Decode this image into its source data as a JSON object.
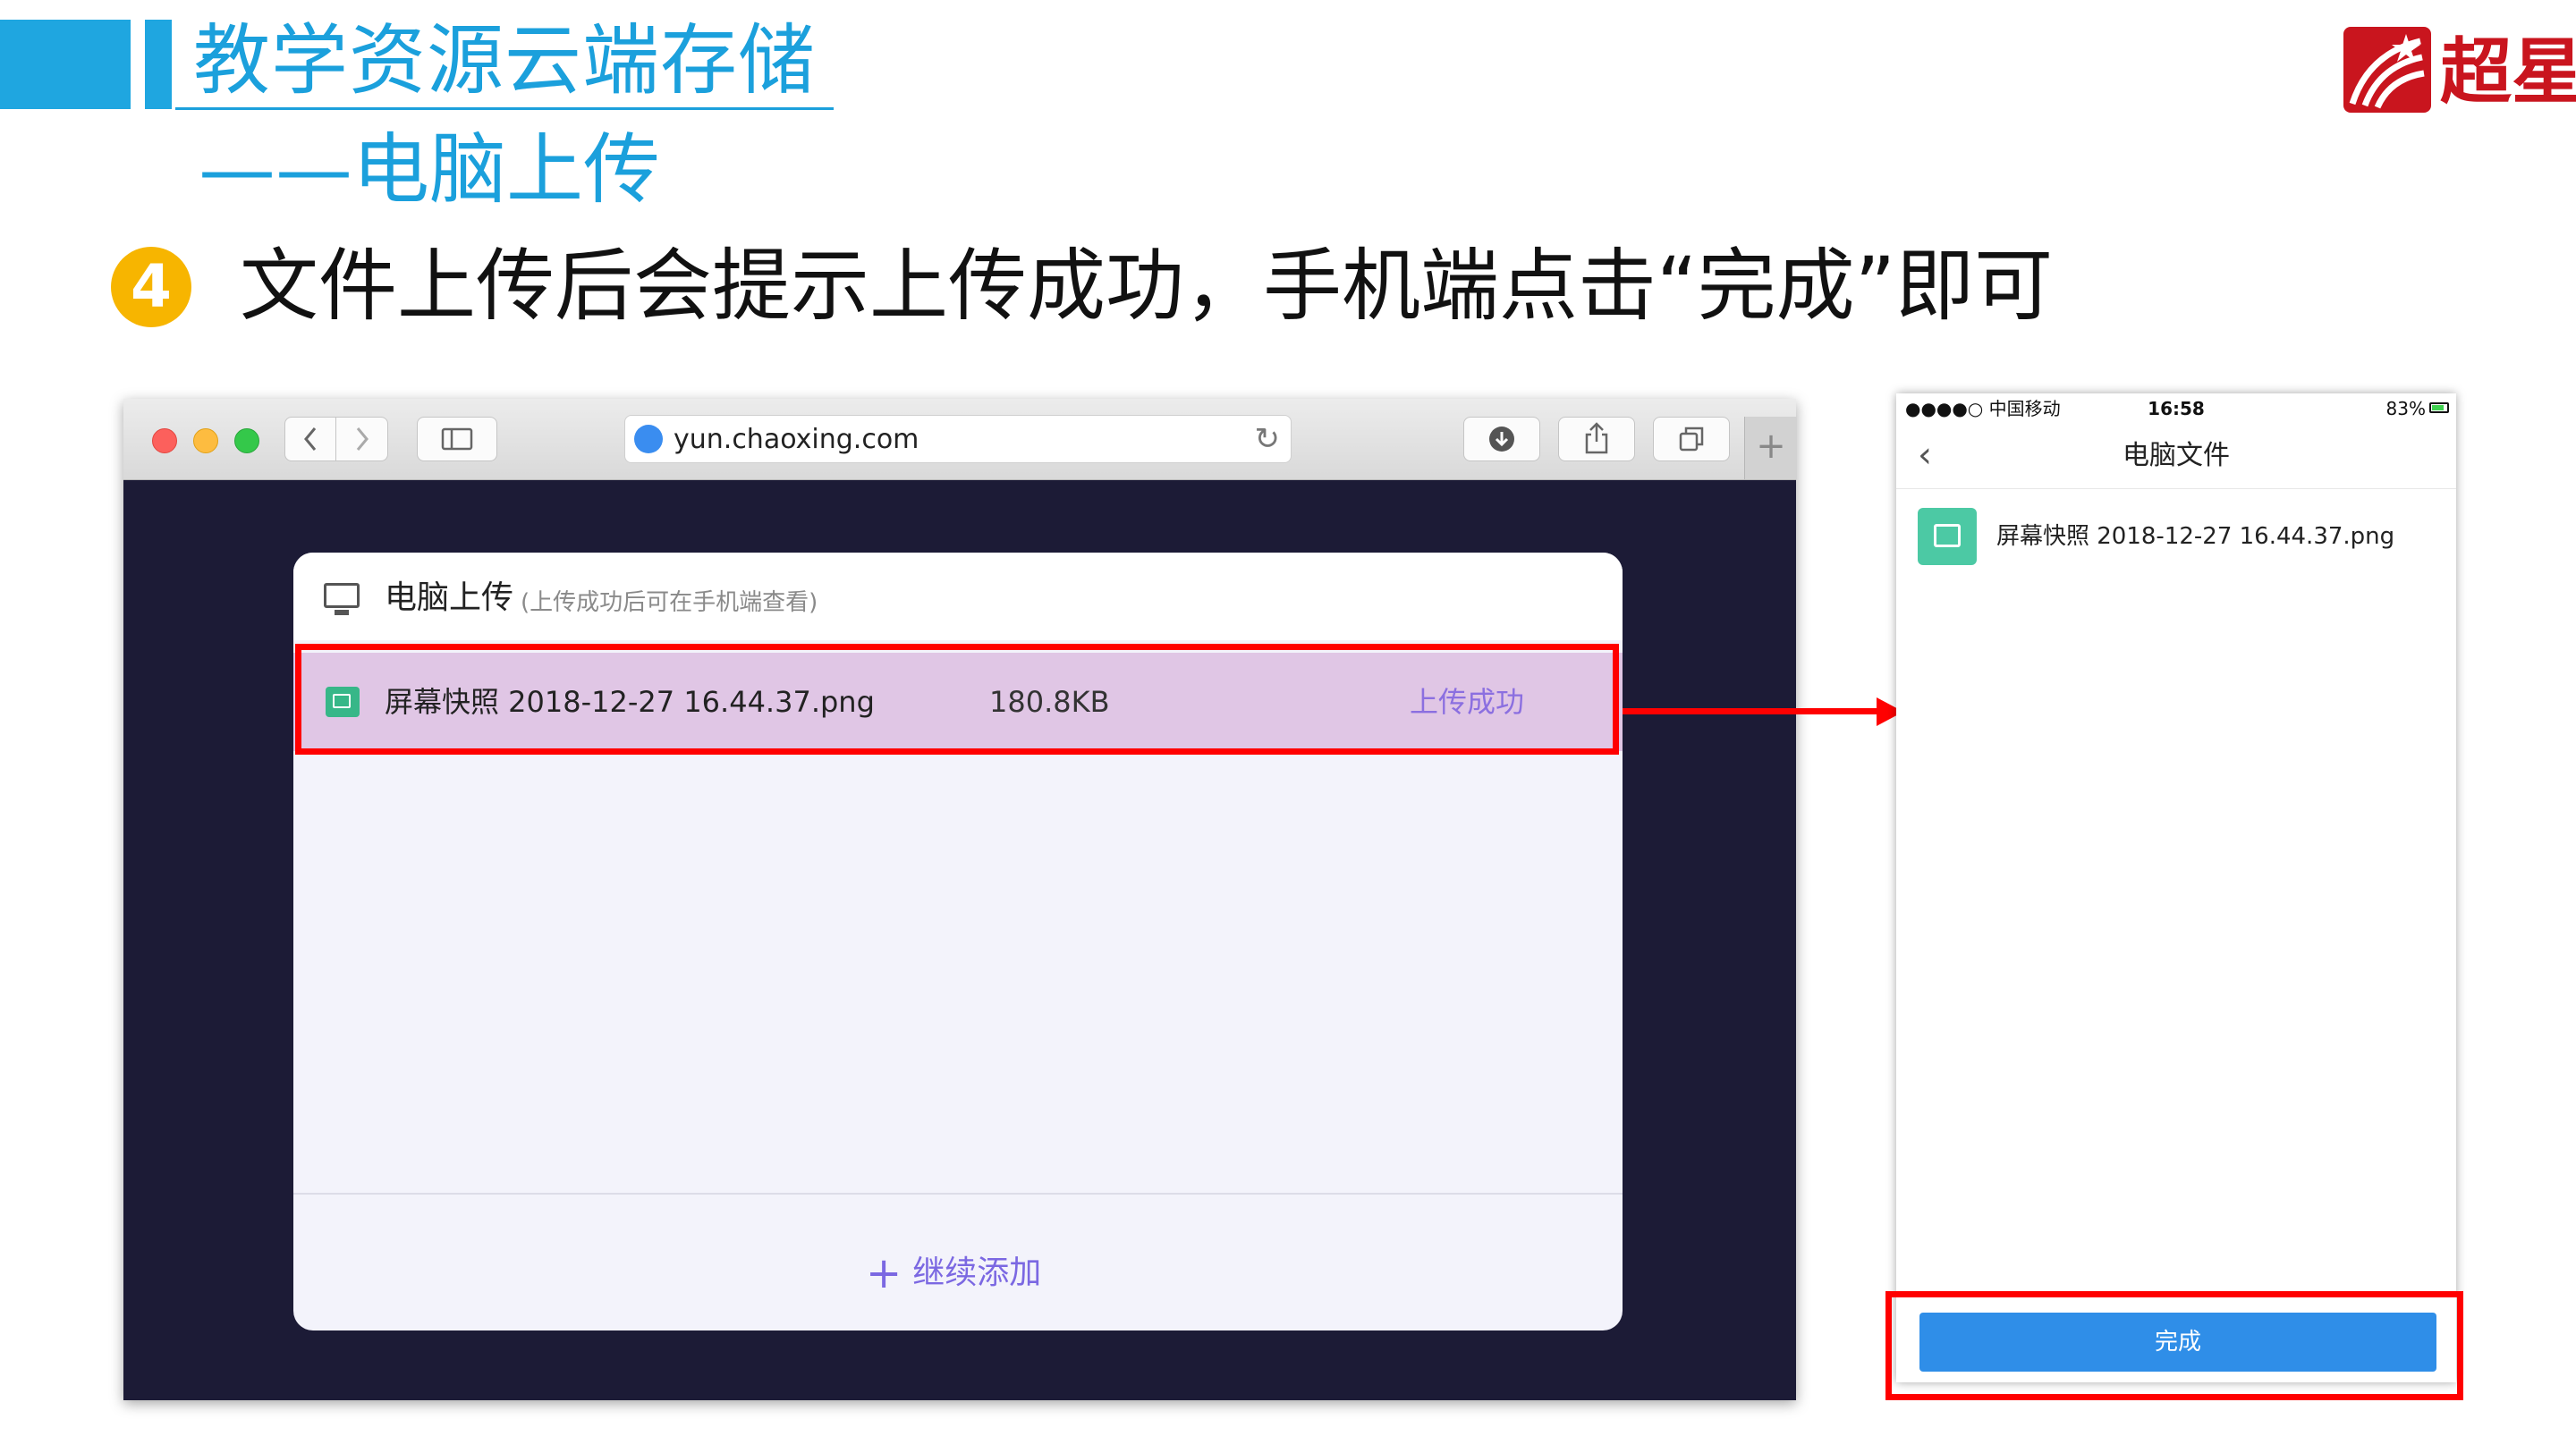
{
  "slide": {
    "title": "教学资源云端存储",
    "subtitle": "——电脑上传",
    "step_number": "4",
    "step_text": "文件上传后会提示上传成功，手机端点击“完成”即可",
    "logo_text": "超星"
  },
  "colors": {
    "accent_blue": "#1ba0dc",
    "highlight_red": "#ff0000",
    "step_badge": "#f7b500",
    "success_purple": "#8b6fe0",
    "row_highlight": "#e0c6e5",
    "done_button": "#2f8ee8"
  },
  "browser": {
    "url": "yun.chaoxing.com",
    "icons": {
      "back": "chevron-left-icon",
      "forward": "chevron-right-icon",
      "sidebar": "sidebar-icon",
      "globe": "globe-icon",
      "reload": "reload-icon",
      "download": "download-icon",
      "share": "share-icon",
      "tabs": "tabs-icon",
      "new_tab": "plus-icon"
    }
  },
  "upload_panel": {
    "title": "电脑上传",
    "hint": "(上传成功后可在手机端查看)",
    "files": [
      {
        "name": "屏幕快照 2018-12-27 16.44.37.png",
        "size": "180.8KB",
        "status": "上传成功"
      }
    ],
    "add_more": "继续添加"
  },
  "phone": {
    "carrier": "●●●●○ 中国移动",
    "time": "16:58",
    "battery": "83%",
    "battery_level": 0.83,
    "nav_title": "电脑文件",
    "files": [
      {
        "name": "屏幕快照 2018-12-27 16.44.37.png"
      }
    ],
    "done_button": "完成"
  }
}
